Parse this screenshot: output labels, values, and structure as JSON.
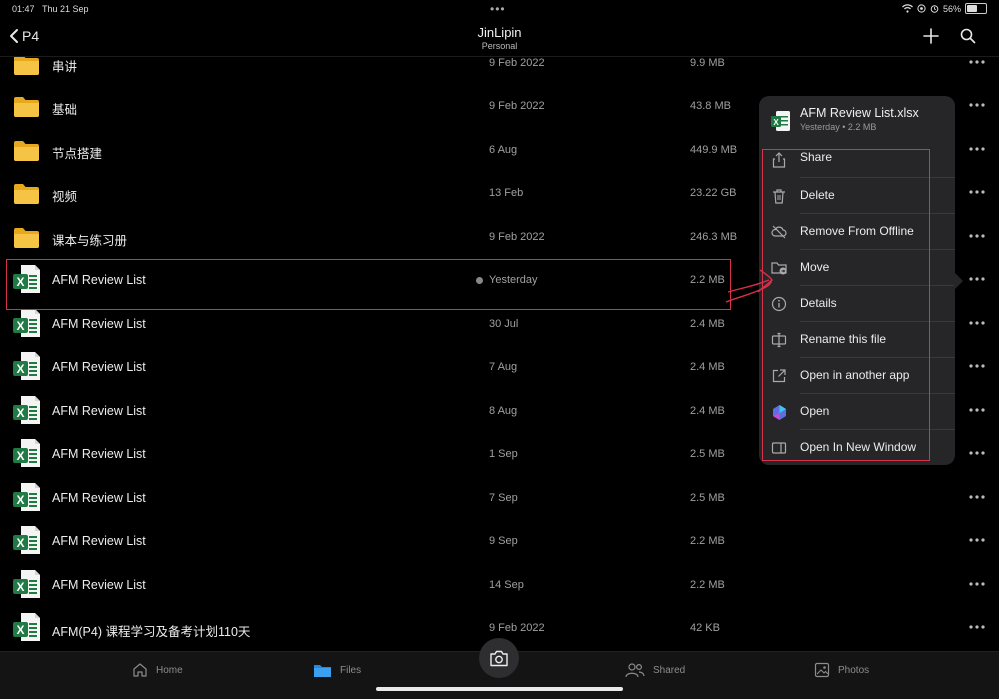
{
  "status_bar": {
    "time": "01:47",
    "date": "Thu 21 Sep",
    "battery": "56%",
    "battery_level": 0.56
  },
  "nav": {
    "back_label": "P4",
    "title": "JinLipin",
    "subtitle": "Personal"
  },
  "files": [
    {
      "type": "folder",
      "name": "串讲",
      "date": "9 Feb 2022",
      "size": "9.9 MB"
    },
    {
      "type": "folder",
      "name": "基础",
      "date": "9 Feb 2022",
      "size": "43.8 MB"
    },
    {
      "type": "folder",
      "name": "节点搭建",
      "date": "6 Aug",
      "size": "449.9 MB"
    },
    {
      "type": "folder",
      "name": "视频",
      "date": "13 Feb",
      "size": "23.22 GB"
    },
    {
      "type": "folder",
      "name": "课本与练习册",
      "date": "9 Feb 2022",
      "size": "246.3 MB"
    },
    {
      "type": "excel",
      "name": "AFM Review List",
      "date": "Yesterday",
      "size": "2.2 MB",
      "selected": true
    },
    {
      "type": "excel",
      "name": "AFM Review List",
      "date": "30 Jul",
      "size": "2.4 MB"
    },
    {
      "type": "excel",
      "name": "AFM Review List",
      "date": "7 Aug",
      "size": "2.4 MB"
    },
    {
      "type": "excel",
      "name": "AFM Review List",
      "date": "8 Aug",
      "size": "2.4 MB"
    },
    {
      "type": "excel",
      "name": "AFM Review List",
      "date": "1 Sep",
      "size": "2.5 MB"
    },
    {
      "type": "excel",
      "name": "AFM Review List",
      "date": "7 Sep",
      "size": "2.5 MB"
    },
    {
      "type": "excel",
      "name": "AFM Review List",
      "date": "9 Sep",
      "size": "2.2 MB"
    },
    {
      "type": "excel",
      "name": "AFM Review List",
      "date": "14 Sep",
      "size": "2.2 MB"
    },
    {
      "type": "excel",
      "name": "AFM(P4) 课程学习及备考计划110天",
      "date": "9 Feb 2022",
      "size": "42 KB"
    }
  ],
  "popover": {
    "file_name": "AFM Review List.xlsx",
    "file_meta": "Yesterday • 2.2 MB",
    "items": [
      {
        "label": "Share",
        "icon": "share-icon"
      },
      {
        "label": "Delete",
        "icon": "trash-icon"
      },
      {
        "label": "Remove From Offline",
        "icon": "cloud-off-icon"
      },
      {
        "label": "Move",
        "icon": "folder-move-icon"
      },
      {
        "label": "Details",
        "icon": "info-icon"
      },
      {
        "label": "Rename this file",
        "icon": "rename-icon"
      },
      {
        "label": "Open in another app",
        "icon": "open-external-icon"
      },
      {
        "label": "Open",
        "icon": "copilot-icon"
      },
      {
        "label": "Open In New Window",
        "icon": "new-window-icon"
      }
    ]
  },
  "tabs": [
    {
      "label": "Home",
      "icon": "home-icon",
      "active": false
    },
    {
      "label": "Files",
      "icon": "folder-icon",
      "active": true
    },
    {
      "label": "Shared",
      "icon": "people-icon",
      "active": false
    },
    {
      "label": "Photos",
      "icon": "photo-icon",
      "active": false
    }
  ],
  "colors": {
    "accent": "#2b88d8",
    "folder": "#f6c445",
    "excel": "#1f7a44",
    "annotation": "#d8314a",
    "background": "#000000",
    "popover": "#262628"
  }
}
